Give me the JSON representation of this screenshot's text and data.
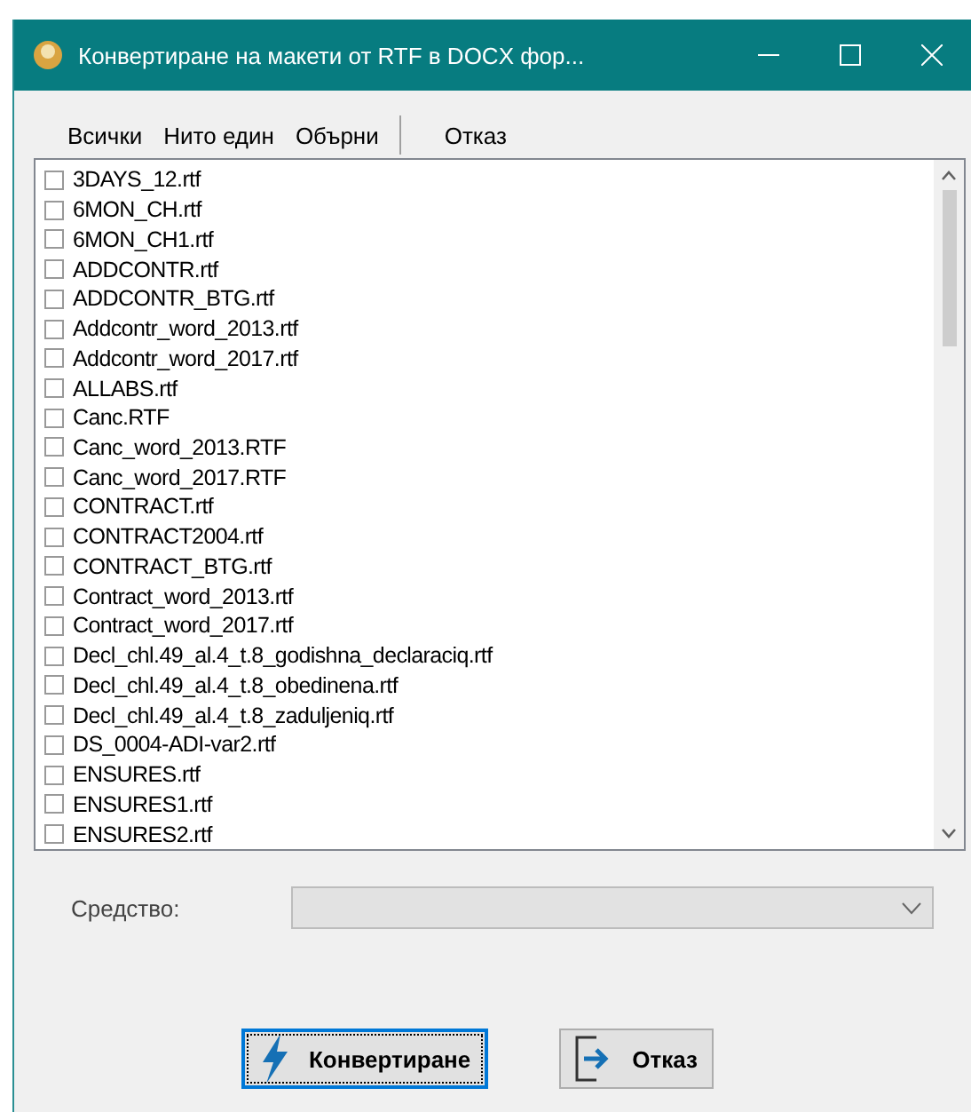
{
  "window": {
    "title": "Конвертиране на макети от RTF в DOCX фор..."
  },
  "toolbar": [
    {
      "kind": "link",
      "label": "Всички"
    },
    {
      "kind": "link",
      "label": "Нито един"
    },
    {
      "kind": "link",
      "label": "Обърни"
    },
    {
      "kind": "separator"
    },
    {
      "kind": "link",
      "label": "Отказ"
    }
  ],
  "files": [
    {
      "name": "3DAYS_12.rtf",
      "checked": false
    },
    {
      "name": "6MON_CH.rtf",
      "checked": false
    },
    {
      "name": "6MON_CH1.rtf",
      "checked": false
    },
    {
      "name": "ADDCONTR.rtf",
      "checked": false
    },
    {
      "name": "ADDCONTR_BTG.rtf",
      "checked": false
    },
    {
      "name": "Addcontr_word_2013.rtf",
      "checked": false
    },
    {
      "name": "Addcontr_word_2017.rtf",
      "checked": false
    },
    {
      "name": "ALLABS.rtf",
      "checked": false
    },
    {
      "name": "Canc.RTF",
      "checked": false
    },
    {
      "name": "Canc_word_2013.RTF",
      "checked": false
    },
    {
      "name": "Canc_word_2017.RTF",
      "checked": false
    },
    {
      "name": "CONTRACT.rtf",
      "checked": false
    },
    {
      "name": "CONTRACT2004.rtf",
      "checked": false
    },
    {
      "name": "CONTRACT_BTG.rtf",
      "checked": false
    },
    {
      "name": "Contract_word_2013.rtf",
      "checked": false
    },
    {
      "name": "Contract_word_2017.rtf",
      "checked": false
    },
    {
      "name": "Decl_chl.49_al.4_t.8_godishna_declaraciq.rtf",
      "checked": false
    },
    {
      "name": "Decl_chl.49_al.4_t.8_obedinena.rtf",
      "checked": false
    },
    {
      "name": "Decl_chl.49_al.4_t.8_zaduljeniq.rtf",
      "checked": false
    },
    {
      "name": "DS_0004-ADI-var2.rtf",
      "checked": false
    },
    {
      "name": "ENSURES.rtf",
      "checked": false
    },
    {
      "name": "ENSURES1.rtf",
      "checked": false
    },
    {
      "name": "ENSURES2.rtf",
      "checked": false
    }
  ],
  "tool": {
    "label": "Средство:",
    "disabled": true
  },
  "buttons": [
    {
      "kind": "convert",
      "label": "Конвертиране",
      "focused": true
    },
    {
      "kind": "cancel",
      "label": "Отказ",
      "focused": false
    }
  ]
}
